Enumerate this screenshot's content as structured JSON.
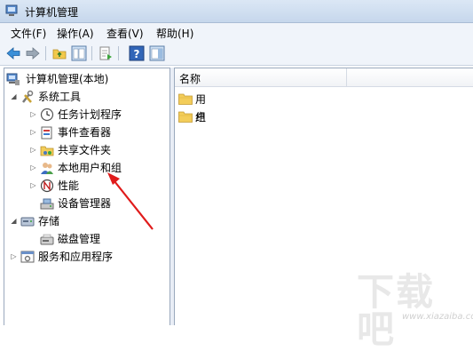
{
  "window": {
    "title": "计算机管理"
  },
  "menu": [
    {
      "label": "文件(F)"
    },
    {
      "label": "操作(A)"
    },
    {
      "label": "查看(V)"
    },
    {
      "label": "帮助(H)"
    }
  ],
  "toolbar": {
    "buttons": [
      "back-icon",
      "forward-icon",
      "up-folder-icon",
      "show-hide-tree-icon",
      "export-list-icon",
      "help-icon",
      "action-pane-icon"
    ]
  },
  "tree": {
    "root": "计算机管理(本地)",
    "system_tools": "系统工具",
    "task_scheduler": "任务计划程序",
    "event_viewer": "事件查看器",
    "shared_folders": "共享文件夹",
    "local_users_groups": "本地用户和组",
    "performance": "性能",
    "device_manager": "设备管理器",
    "storage": "存储",
    "disk_management": "磁盘管理",
    "services_apps": "服务和应用程序"
  },
  "list": {
    "column_name": "名称",
    "items": [
      {
        "label": "用户"
      },
      {
        "label": "组"
      }
    ]
  },
  "watermark": {
    "logo": "下载吧",
    "site": "www.xiazaiba.com"
  },
  "colors": {
    "arrow": "#e01b1b",
    "folder": "#f3cd5a",
    "selection": "#dce9f8"
  }
}
